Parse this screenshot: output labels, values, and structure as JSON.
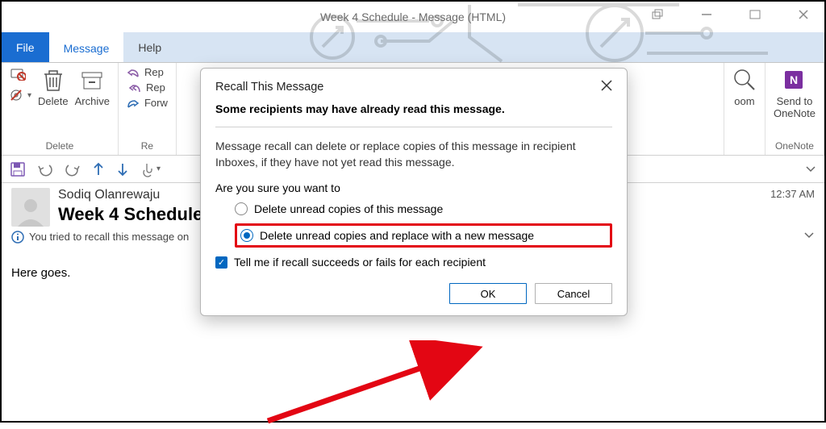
{
  "window": {
    "title": "Week 4 Schedule  -  Message (HTML)"
  },
  "tabs": {
    "file": "File",
    "message": "Message",
    "help": "Help"
  },
  "ribbon": {
    "delete_btn": "Delete",
    "archive_btn": "Archive",
    "delete_group": "Delete",
    "reply": "Rep",
    "reply_all": "Rep",
    "forward": "Forw",
    "re_group": "Re",
    "zoom_btn": "oom",
    "onenote_btn": "Send to\nOneNote",
    "onenote_group": "OneNote"
  },
  "msg": {
    "sender": "Sodiq Olanrewaju",
    "subject": "Week 4 Schedule",
    "timestamp": "12:37 AM",
    "infobar": "You tried to recall this message on",
    "body": "Here goes."
  },
  "dialog": {
    "title": "Recall This Message",
    "heading": "Some recipients may have already read this message.",
    "desc": "Message recall can delete or replace copies of this message in recipient Inboxes, if they have not yet read this message.",
    "question": "Are you sure you want to",
    "option1": "Delete unread copies of this message",
    "option2": "Delete unread copies and replace with a new message",
    "checkbox": "Tell me if recall succeeds or fails for each recipient",
    "ok": "OK",
    "cancel": "Cancel"
  }
}
